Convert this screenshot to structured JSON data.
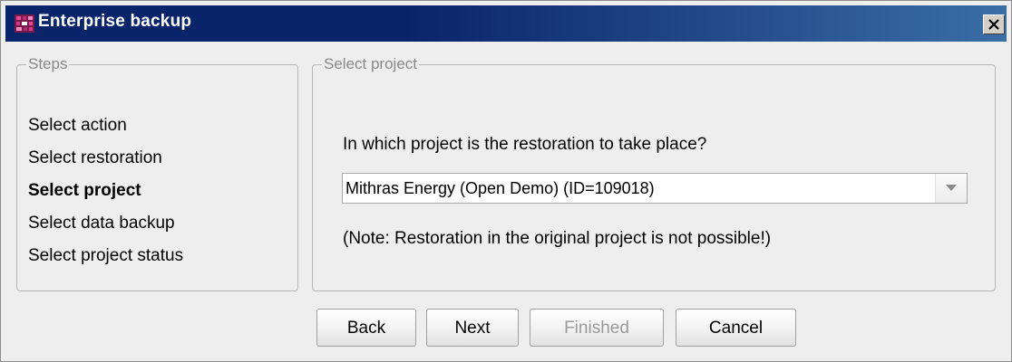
{
  "window": {
    "title": "Enterprise backup"
  },
  "steps": {
    "legend": "Steps",
    "items": [
      {
        "label": "Select action",
        "active": false
      },
      {
        "label": "Select restoration",
        "active": false
      },
      {
        "label": "Select project",
        "active": true
      },
      {
        "label": "Select data backup",
        "active": false
      },
      {
        "label": "Select project status",
        "active": false
      }
    ]
  },
  "project": {
    "legend": "Select project",
    "question": "In which project is the restoration to take place?",
    "selected": "Mithras Energy (Open Demo) (ID=109018)",
    "note": "(Note: Restoration in the original project is not possible!)"
  },
  "buttons": {
    "back": "Back",
    "next": "Next",
    "finished": "Finished",
    "cancel": "Cancel"
  },
  "icons": {
    "app": "enterprise-backup-icon",
    "close": "close-icon",
    "dropdown": "chevron-down-icon"
  },
  "colors": {
    "titlebar": "#0a246a",
    "titlebar_gradient_end": "#3a6ea5",
    "window_bg": "#eeeeee",
    "disabled_text": "#9a9a9a"
  }
}
